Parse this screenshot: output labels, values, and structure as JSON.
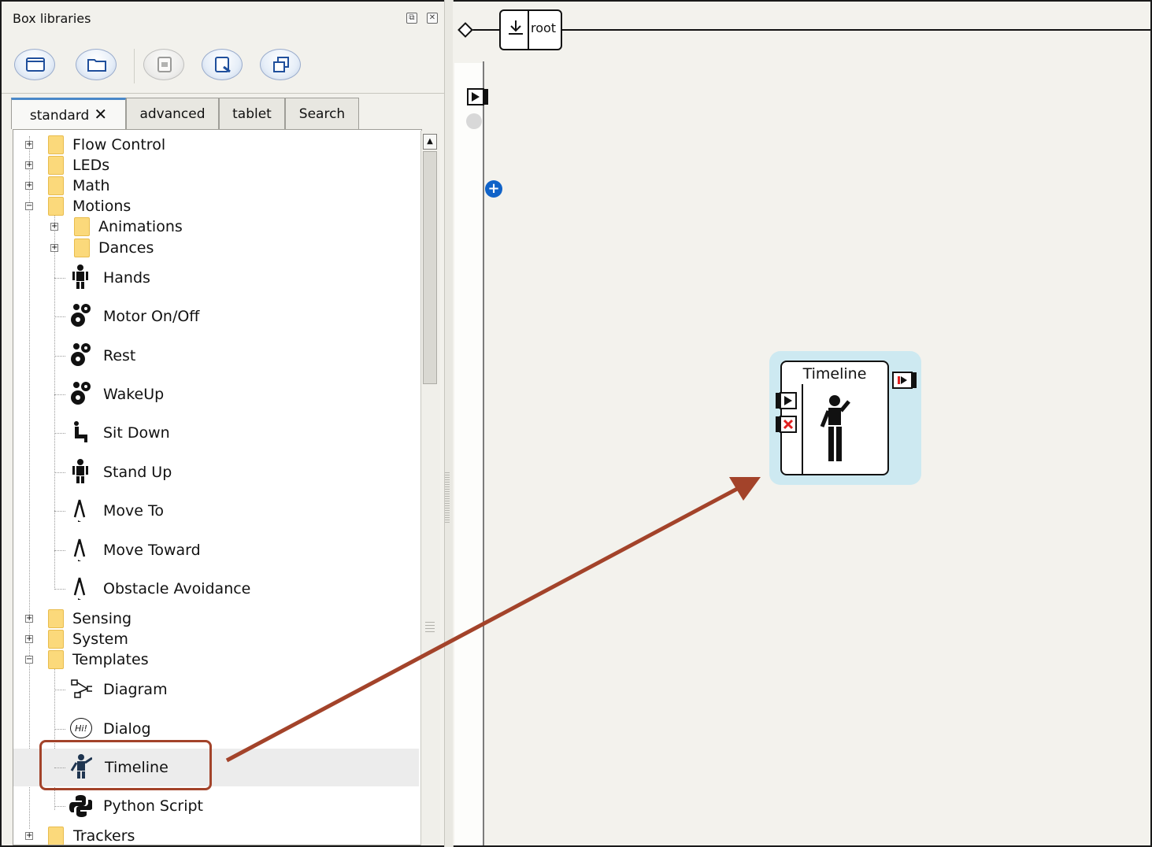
{
  "panel": {
    "title": "Box libraries",
    "float_btn": "⧉",
    "close_btn": "✕"
  },
  "toolbar": {
    "buttons": [
      "new-library-icon",
      "open-library-icon",
      "save-library-icon",
      "edit-library-icon",
      "copy-library-icon"
    ]
  },
  "tabs": {
    "standard": "standard",
    "close": "✕",
    "advanced": "advanced",
    "tablet": "tablet",
    "search": "Search"
  },
  "tree": {
    "flow_control": "Flow Control",
    "leds": "LEDs",
    "math": "Math",
    "motions": "Motions",
    "animations": "Animations",
    "dances": "Dances",
    "hands": "Hands",
    "motor_onoff": "Motor On/Off",
    "rest": "Rest",
    "wakeup": "WakeUp",
    "sit_down": "Sit Down",
    "stand_up": "Stand Up",
    "move_to": "Move To",
    "move_toward": "Move Toward",
    "obstacle_avoidance": "Obstacle Avoidance",
    "sensing": "Sensing",
    "system": "System",
    "templates": "Templates",
    "diagram": "Diagram",
    "dialog": "Dialog",
    "timeline": "Timeline",
    "python_script": "Python Script",
    "trackers": "Trackers"
  },
  "glyphs": {
    "plus": "+",
    "minus": "−",
    "up": "▲",
    "hi": "Hi!"
  },
  "canvas": {
    "root_label": "root",
    "timeline_box_title": "Timeline"
  },
  "colors": {
    "highlight": "#a3432a",
    "box_bg": "#cde9f1",
    "folder": "#fbd97b",
    "accent_tab": "#4a88c8",
    "stop_red": "#e02020"
  }
}
